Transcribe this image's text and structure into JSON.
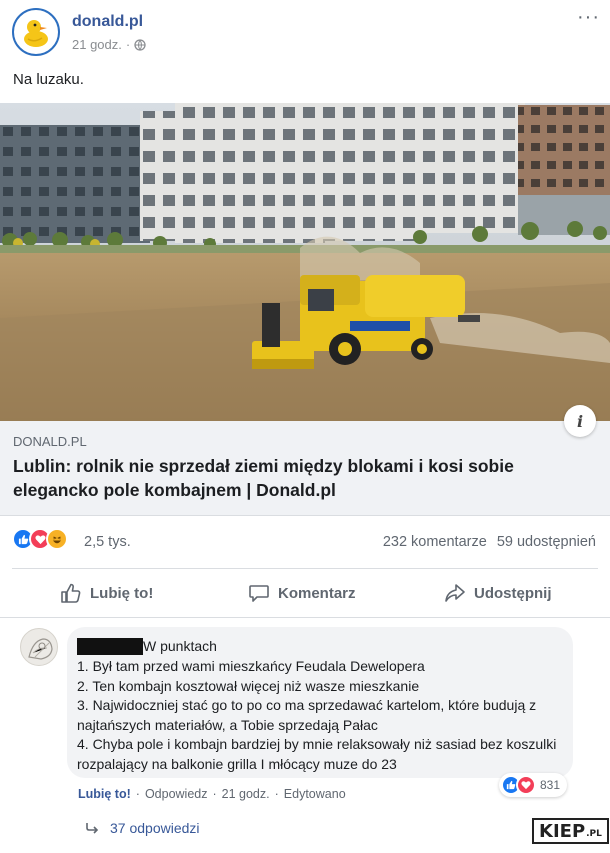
{
  "post": {
    "page_name": "donald.pl",
    "time": "21 godz.",
    "privacy_icon": "globe-icon",
    "text": "Na luzaku.",
    "image_alt": "combine-harvester-photo"
  },
  "link_preview": {
    "domain": "DONALD.PL",
    "title": "Lublin: rolnik nie sprzedał ziemi między blokami i kosi sobie elegancko pole kombajnem | Donald.pl",
    "info_icon": "info-icon"
  },
  "stats": {
    "reactions": [
      "like",
      "love",
      "haha"
    ],
    "reaction_count": "2,5 tys.",
    "comments": "232 komentarze",
    "shares": "59 udostępnień"
  },
  "actions": {
    "like": "Lubię to!",
    "comment": "Komentarz",
    "share": "Udostępnij"
  },
  "comment": {
    "header": "W punktach",
    "lines": [
      "1. Był tam przed wami mieszkańcy Feudala Dewelopera",
      "2. Ten kombajn kosztował więcej niż wasze mieszkanie",
      "3. Najwidoczniej stać go to po co ma sprzedawać kartelom, które budują z najtańszych materiałów, a Tobie sprzedają Pałac",
      "4. Chyba pole i kombajn bardziej by mnie relaksowały niż sasiad bez koszulki rozpalający na balkonie grilla I młócący muze do 23"
    ],
    "reaction_count": "831",
    "like_link": "Lubię to!",
    "reply_link": "Odpowiedz",
    "time": "21 godz.",
    "edited": "Edytowano",
    "replies": "37 odpowiedzi"
  },
  "watermark": {
    "main": "KIEP",
    "suffix": ".PL"
  },
  "colors": {
    "brand_blue": "#385898",
    "like_blue": "#1877f2",
    "love_red": "#f33e58",
    "haha_yellow": "#f7b125",
    "harvester_yellow": "#e8c21c"
  }
}
